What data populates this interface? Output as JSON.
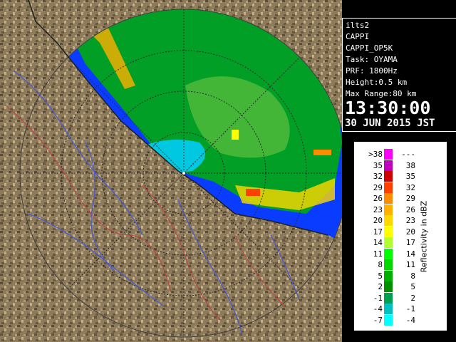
{
  "info": {
    "site": "ilts2",
    "product": "CAPPI",
    "product_id": "CAPPI_OP5K",
    "task": "Task: OYAMA",
    "prf": "PRF: 1800Hz",
    "height": "Height:0.5 km",
    "max_range": "Max Range:80 km",
    "time": "13:30:00",
    "date": "30 JUN 2015 JST"
  },
  "legend": {
    "unit_label": "Reflectivity in dBZ",
    "rows": [
      {
        "low": ">38",
        "high": "---",
        "color": "#ff00ff"
      },
      {
        "low": "35",
        "high": "38",
        "color": "#c000c0"
      },
      {
        "low": "32",
        "high": "35",
        "color": "#d00000"
      },
      {
        "low": "29",
        "high": "32",
        "color": "#ff4000"
      },
      {
        "low": "26",
        "high": "29",
        "color": "#ff8c00"
      },
      {
        "low": "23",
        "high": "26",
        "color": "#ffb000"
      },
      {
        "low": "20",
        "high": "23",
        "color": "#ffd800"
      },
      {
        "low": "17",
        "high": "20",
        "color": "#ffff00"
      },
      {
        "low": "14",
        "high": "17",
        "color": "#b0ff30"
      },
      {
        "low": "11",
        "high": "14",
        "color": "#00ff00"
      },
      {
        "low": "8",
        "high": "11",
        "color": "#00d800"
      },
      {
        "low": "5",
        "high": "8",
        "color": "#00b000"
      },
      {
        "low": "2",
        "high": "5",
        "color": "#009000"
      },
      {
        "low": "-1",
        "high": "2",
        "color": "#00a050"
      },
      {
        "low": "-4",
        "high": "-1",
        "color": "#00c0c0"
      },
      {
        "low": "-7",
        "high": "-4",
        "color": "#00ffff"
      }
    ]
  },
  "colors": {
    "land": "#8c7a5a",
    "sea": "#0a3cff",
    "rain_light": "#00d800",
    "background": "#000000"
  }
}
